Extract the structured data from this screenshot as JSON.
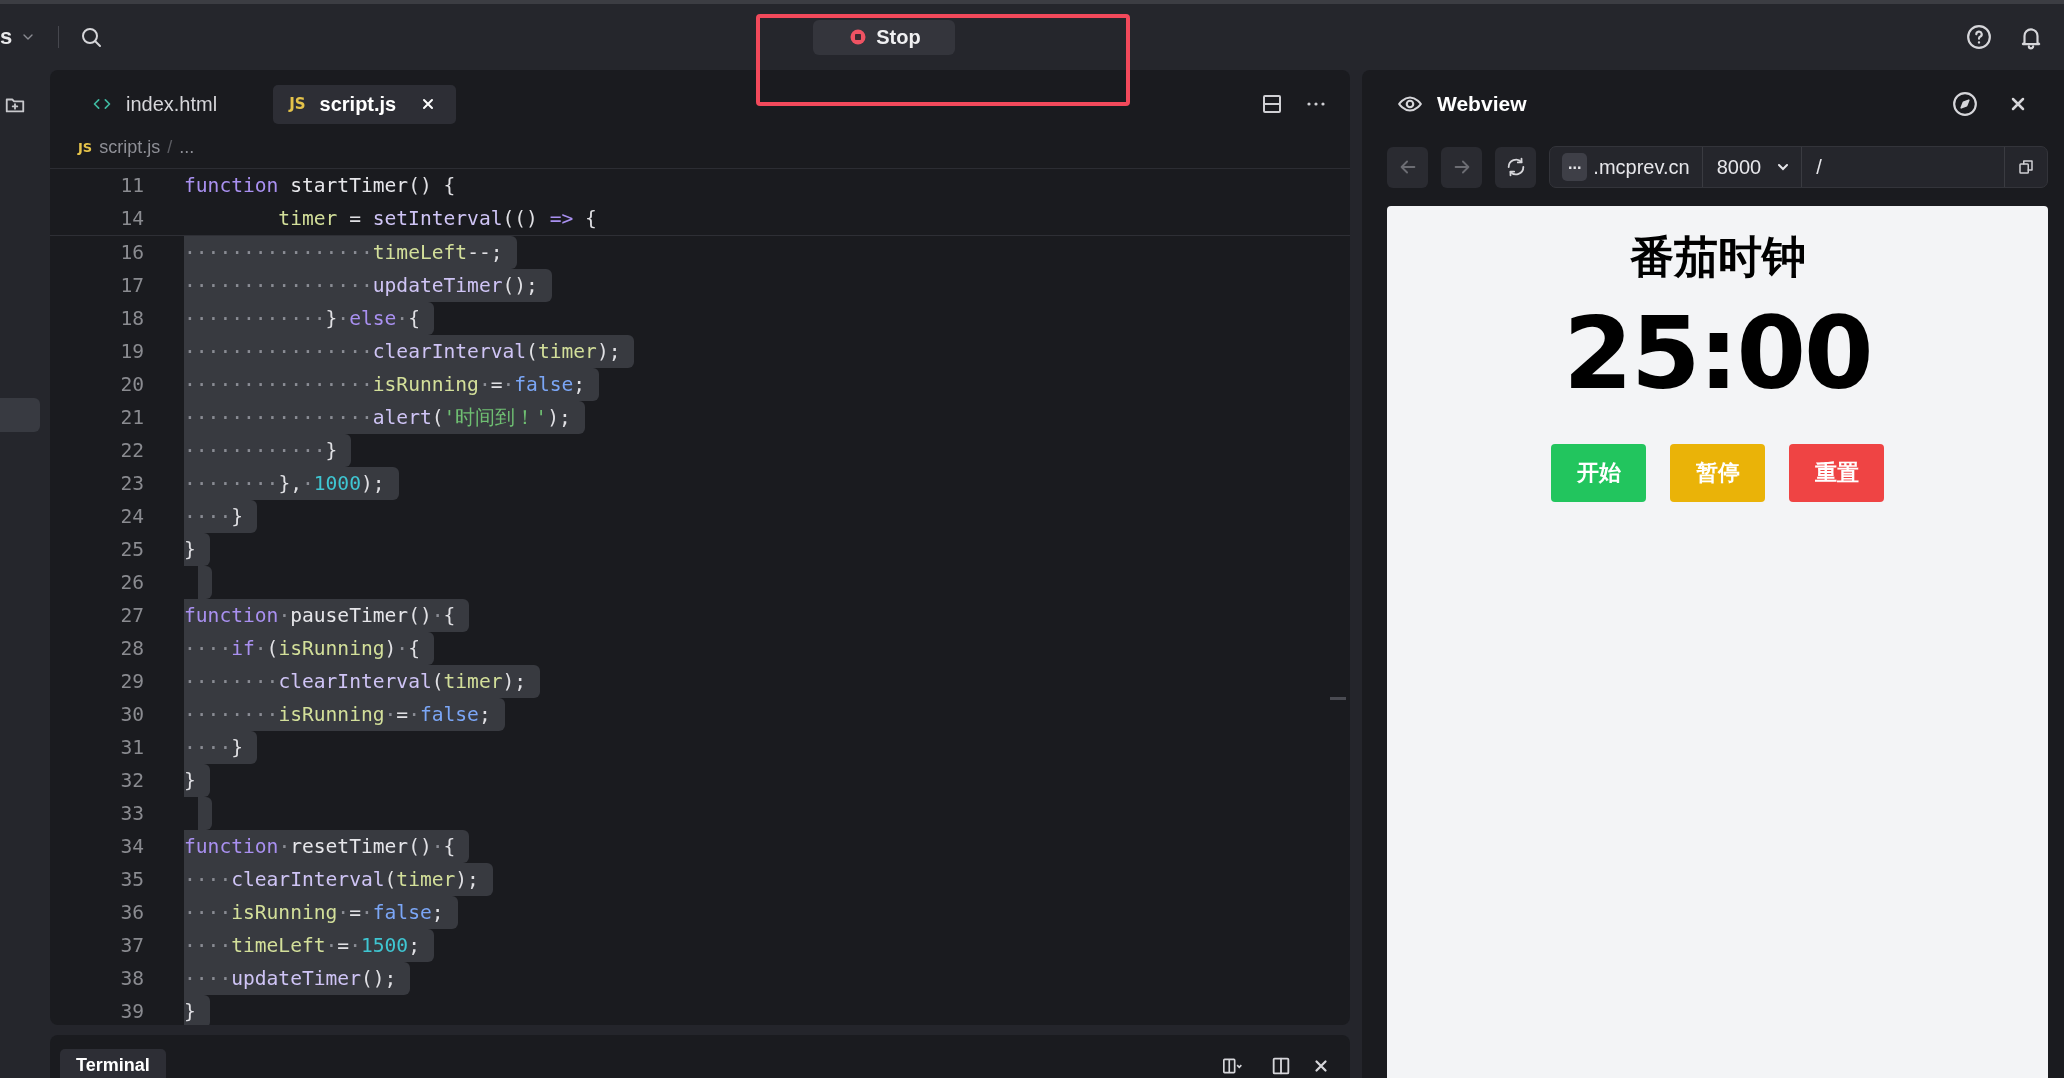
{
  "topbar": {
    "workspace": "s",
    "stop_button": "Stop"
  },
  "annotation": {
    "kind": "box"
  },
  "activity_bar": {
    "items": [
      {
        "kind": "new-folder",
        "selected": false
      },
      {
        "kind": "blank",
        "selected": true
      }
    ]
  },
  "editor": {
    "tabs": [
      {
        "label": "index.html",
        "kind": "html",
        "selected": false
      },
      {
        "label": "script.js",
        "kind": "js",
        "badge": "JS",
        "selected": true
      }
    ],
    "breadcrumb": {
      "badge": "JS",
      "file": "script.js",
      "separator": "/",
      "rest": "..."
    },
    "sticky_lines": [
      {
        "number": "11",
        "tokens": [
          {
            "kind": "keyword",
            "text": "function "
          },
          {
            "kind": "name",
            "text": "startTimer"
          },
          {
            "kind": "punct",
            "text": "() {"
          }
        ],
        "children": [
          {
            "number": "14",
            "tokens": [
              {
                "kind": "variable",
                "text": "timer"
              },
              {
                "kind": "punct",
                "text": " = "
              },
              {
                "kind": "call",
                "text": "setInterval"
              },
              {
                "kind": "punct",
                "text": "(() "
              },
              {
                "kind": "keyword",
                "text": "=>"
              },
              {
                "kind": "punct",
                "text": " {"
              }
            ]
          }
        ]
      }
    ],
    "lines": [
      {
        "number": "16",
        "selected": true,
        "tokens": [
          {
            "kind": "whitespace",
            "text": "················"
          },
          {
            "kind": "variable",
            "text": "timeLeft"
          },
          {
            "kind": "punct",
            "text": "--;"
          }
        ]
      },
      {
        "number": "17",
        "selected": true,
        "tokens": [
          {
            "kind": "whitespace",
            "text": "················"
          },
          {
            "kind": "call",
            "text": "updateTimer"
          },
          {
            "kind": "punct",
            "text": "();"
          }
        ]
      },
      {
        "number": "18",
        "selected": true,
        "tokens": [
          {
            "kind": "whitespace",
            "text": "············"
          },
          {
            "kind": "punct",
            "text": "}"
          },
          {
            "kind": "whitespace",
            "text": "·"
          },
          {
            "kind": "keyword",
            "text": "else"
          },
          {
            "kind": "whitespace",
            "text": "·"
          },
          {
            "kind": "punct",
            "text": "{"
          }
        ]
      },
      {
        "number": "19",
        "selected": true,
        "tokens": [
          {
            "kind": "whitespace",
            "text": "················"
          },
          {
            "kind": "call",
            "text": "clearInterval"
          },
          {
            "kind": "punct",
            "text": "("
          },
          {
            "kind": "variable",
            "text": "timer"
          },
          {
            "kind": "punct",
            "text": ");"
          }
        ]
      },
      {
        "number": "20",
        "selected": true,
        "tokens": [
          {
            "kind": "whitespace",
            "text": "················"
          },
          {
            "kind": "variable",
            "text": "isRunning"
          },
          {
            "kind": "whitespace",
            "text": "·"
          },
          {
            "kind": "punct",
            "text": "="
          },
          {
            "kind": "whitespace",
            "text": "·"
          },
          {
            "kind": "bool",
            "text": "false"
          },
          {
            "kind": "punct",
            "text": ";"
          }
        ]
      },
      {
        "number": "21",
        "selected": true,
        "tokens": [
          {
            "kind": "whitespace",
            "text": "················"
          },
          {
            "kind": "call",
            "text": "alert"
          },
          {
            "kind": "punct",
            "text": "("
          },
          {
            "kind": "string",
            "text": "'时间到！'"
          },
          {
            "kind": "punct",
            "text": ");"
          }
        ]
      },
      {
        "number": "22",
        "selected": true,
        "tokens": [
          {
            "kind": "whitespace",
            "text": "············"
          },
          {
            "kind": "punct",
            "text": "}"
          }
        ]
      },
      {
        "number": "23",
        "selected": true,
        "tokens": [
          {
            "kind": "whitespace",
            "text": "········"
          },
          {
            "kind": "punct",
            "text": "},"
          },
          {
            "kind": "whitespace",
            "text": "·"
          },
          {
            "kind": "number",
            "text": "1000"
          },
          {
            "kind": "punct",
            "text": ");"
          }
        ]
      },
      {
        "number": "24",
        "selected": true,
        "tokens": [
          {
            "kind": "whitespace",
            "text": "····"
          },
          {
            "kind": "punct",
            "text": "}"
          }
        ]
      },
      {
        "number": "25",
        "selected": true,
        "tokens": [
          {
            "kind": "punct",
            "text": "}"
          }
        ]
      },
      {
        "number": "26",
        "selected": true
      },
      {
        "number": "27",
        "selected": true,
        "tokens": [
          {
            "kind": "keyword",
            "text": "function"
          },
          {
            "kind": "whitespace",
            "text": "·"
          },
          {
            "kind": "name",
            "text": "pauseTimer"
          },
          {
            "kind": "punct",
            "text": "()"
          },
          {
            "kind": "whitespace",
            "text": "·"
          },
          {
            "kind": "punct",
            "text": "{"
          }
        ]
      },
      {
        "number": "28",
        "selected": true,
        "tokens": [
          {
            "kind": "whitespace",
            "text": "····"
          },
          {
            "kind": "keyword",
            "text": "if"
          },
          {
            "kind": "whitespace",
            "text": "·"
          },
          {
            "kind": "punct",
            "text": "("
          },
          {
            "kind": "variable",
            "text": "isRunning"
          },
          {
            "kind": "punct",
            "text": ")"
          },
          {
            "kind": "whitespace",
            "text": "·"
          },
          {
            "kind": "punct",
            "text": "{"
          }
        ]
      },
      {
        "number": "29",
        "selected": true,
        "tokens": [
          {
            "kind": "whitespace",
            "text": "········"
          },
          {
            "kind": "call",
            "text": "clearInterval"
          },
          {
            "kind": "punct",
            "text": "("
          },
          {
            "kind": "variable",
            "text": "timer"
          },
          {
            "kind": "punct",
            "text": ");"
          }
        ]
      },
      {
        "number": "30",
        "selected": true,
        "tokens": [
          {
            "kind": "whitespace",
            "text": "········"
          },
          {
            "kind": "variable",
            "text": "isRunning"
          },
          {
            "kind": "whitespace",
            "text": "·"
          },
          {
            "kind": "punct",
            "text": "="
          },
          {
            "kind": "whitespace",
            "text": "·"
          },
          {
            "kind": "bool",
            "text": "false"
          },
          {
            "kind": "punct",
            "text": ";"
          }
        ]
      },
      {
        "number": "31",
        "selected": true,
        "tokens": [
          {
            "kind": "whitespace",
            "text": "····"
          },
          {
            "kind": "punct",
            "text": "}"
          }
        ]
      },
      {
        "number": "32",
        "selected": true,
        "tokens": [
          {
            "kind": "punct",
            "text": "}"
          }
        ]
      },
      {
        "number": "33",
        "selected": true
      },
      {
        "number": "34",
        "selected": true,
        "tokens": [
          {
            "kind": "keyword",
            "text": "function"
          },
          {
            "kind": "whitespace",
            "text": "·"
          },
          {
            "kind": "name",
            "text": "resetTimer"
          },
          {
            "kind": "punct",
            "text": "()"
          },
          {
            "kind": "whitespace",
            "text": "·"
          },
          {
            "kind": "punct",
            "text": "{"
          }
        ]
      },
      {
        "number": "35",
        "selected": true,
        "tokens": [
          {
            "kind": "whitespace",
            "text": "····"
          },
          {
            "kind": "call",
            "text": "clearInterval"
          },
          {
            "kind": "punct",
            "text": "("
          },
          {
            "kind": "variable",
            "text": "timer"
          },
          {
            "kind": "punct",
            "text": ");"
          }
        ]
      },
      {
        "number": "36",
        "selected": true,
        "tokens": [
          {
            "kind": "whitespace",
            "text": "····"
          },
          {
            "kind": "variable",
            "text": "isRunning"
          },
          {
            "kind": "whitespace",
            "text": "·"
          },
          {
            "kind": "punct",
            "text": "="
          },
          {
            "kind": "whitespace",
            "text": "·"
          },
          {
            "kind": "bool",
            "text": "false"
          },
          {
            "kind": "punct",
            "text": ";"
          }
        ]
      },
      {
        "number": "37",
        "selected": true,
        "tokens": [
          {
            "kind": "whitespace",
            "text": "····"
          },
          {
            "kind": "variable",
            "text": "timeLeft"
          },
          {
            "kind": "whitespace",
            "text": "·"
          },
          {
            "kind": "punct",
            "text": "="
          },
          {
            "kind": "whitespace",
            "text": "·"
          },
          {
            "kind": "number",
            "text": "1500"
          },
          {
            "kind": "punct",
            "text": ";"
          }
        ]
      },
      {
        "number": "38",
        "selected": true,
        "tokens": [
          {
            "kind": "whitespace",
            "text": "····"
          },
          {
            "kind": "call",
            "text": "updateTimer"
          },
          {
            "kind": "punct",
            "text": "();"
          }
        ]
      },
      {
        "number": "39",
        "selected": true,
        "tokens": [
          {
            "kind": "punct",
            "text": "}"
          }
        ]
      }
    ]
  },
  "terminal": {
    "tabs": [
      {
        "label": "Terminal",
        "selected": true
      }
    ]
  },
  "webview": {
    "title": "Webview",
    "url": {
      "host_prefix": "...",
      "host": ".mcprev.cn",
      "port": "8000",
      "path": "/"
    },
    "page": {
      "title": "番茄时钟",
      "time": "25:00",
      "buttons": [
        {
          "label": "开始",
          "color": "#22c55e"
        },
        {
          "label": "暂停",
          "color": "#eab308"
        },
        {
          "label": "重置",
          "color": "#ef4444"
        }
      ]
    }
  }
}
